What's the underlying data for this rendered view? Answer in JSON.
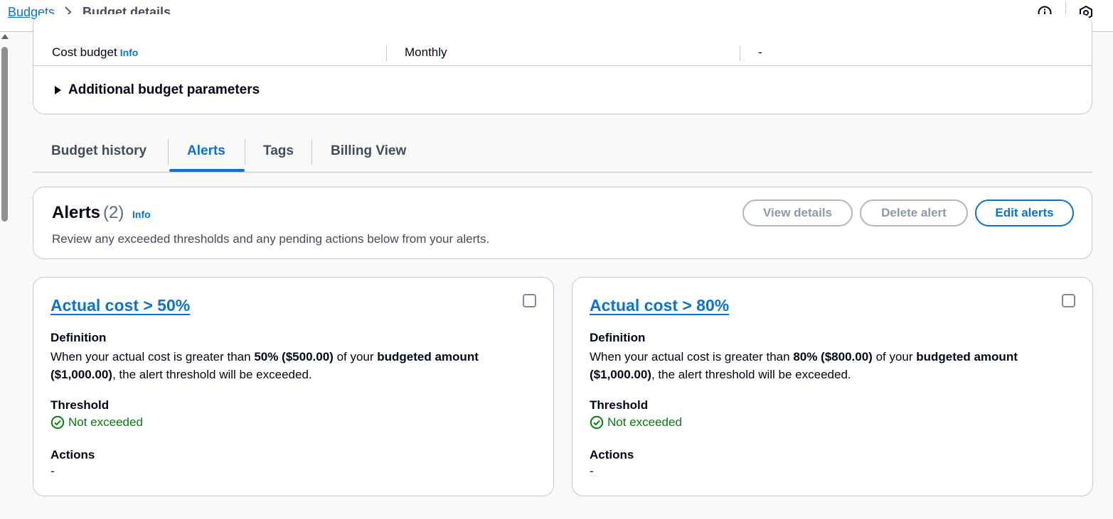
{
  "breadcrumb": {
    "parent": "Budgets",
    "current": "Budget details"
  },
  "icons": {
    "info": "info-circle-icon",
    "settings": "hexagon-settings-icon",
    "chevron": "chevron-right-icon"
  },
  "summary": {
    "budget_type": "Cost budget",
    "budget_type_info": "Info",
    "period": "Monthly",
    "third_value": "-",
    "expander_label": "Additional budget parameters"
  },
  "tabs": [
    {
      "label": "Budget history",
      "active": false
    },
    {
      "label": "Alerts",
      "active": true
    },
    {
      "label": "Tags",
      "active": false
    },
    {
      "label": "Billing View",
      "active": false
    }
  ],
  "alerts": {
    "title": "Alerts",
    "count": "(2)",
    "info": "Info",
    "description": "Review any exceeded thresholds and any pending actions below from your alerts.",
    "buttons": {
      "view_details": "View details",
      "delete_alert": "Delete alert",
      "edit_alerts": "Edit alerts"
    },
    "cards": [
      {
        "title": "Actual cost > 50%",
        "definition_label": "Definition",
        "def_pre": "When your actual cost is greater than ",
        "def_threshold": "50% ($500.00)",
        "def_mid": " of your ",
        "def_budget_label": "budgeted amount",
        "def_budget_value": "($1,000.00)",
        "def_post": ", the alert threshold will be exceeded.",
        "threshold_label": "Threshold",
        "threshold_status": "Not exceeded",
        "actions_label": "Actions",
        "actions_value": "-"
      },
      {
        "title": "Actual cost > 80%",
        "definition_label": "Definition",
        "def_pre": "When your actual cost is greater than ",
        "def_threshold": "80% ($800.00)",
        "def_mid": " of your ",
        "def_budget_label": "budgeted amount",
        "def_budget_value": "($1,000.00)",
        "def_post": ", the alert threshold will be exceeded.",
        "threshold_label": "Threshold",
        "threshold_status": "Not exceeded",
        "actions_label": "Actions",
        "actions_value": "-"
      }
    ]
  },
  "colors": {
    "link": "#0972d3",
    "success": "#037f0c",
    "border": "#c6c6cd"
  }
}
